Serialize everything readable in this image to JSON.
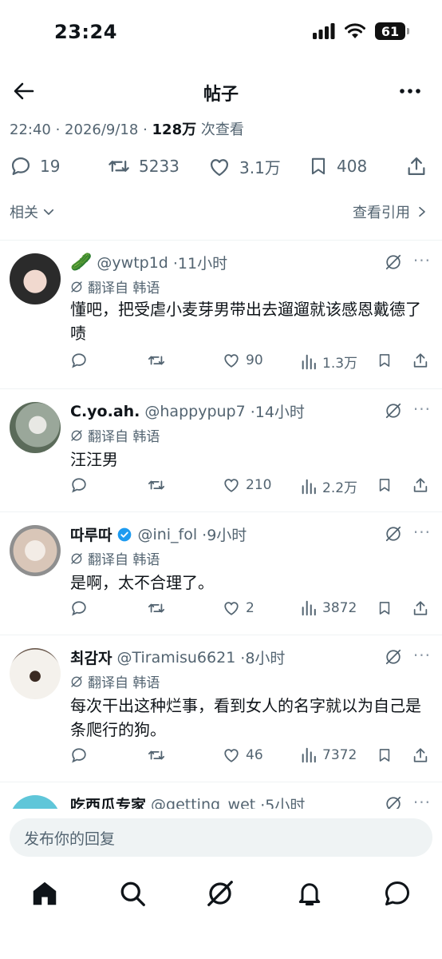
{
  "status_bar": {
    "time": "23:24",
    "battery": "61"
  },
  "header": {
    "title": "帖子"
  },
  "post_meta": {
    "time": "22:40",
    "sep1": " · ",
    "date": "2026/9/18",
    "sep2": " · ",
    "views": "128万",
    "views_suffix": " 次查看"
  },
  "stats": {
    "replies": "19",
    "retweets": "5233",
    "likes": "3.1万",
    "bookmarks": "408"
  },
  "related": {
    "left_label": "相关",
    "right_label": "查看引用"
  },
  "replies": [
    {
      "emoji": "🥒",
      "name": "",
      "handle": "@ywtp1d",
      "time": "·11小时",
      "translate_label": "翻译自 韩语",
      "text": "懂吧，把受虐小麦芽男带出去遛遛就该感恩戴德了啧",
      "likes": "90",
      "views": "1.3万"
    },
    {
      "emoji": "",
      "name": "C.yo.ah.",
      "handle": "@happypup7",
      "time": "·14小时",
      "translate_label": "翻译自 韩语",
      "text": "汪汪男",
      "likes": "210",
      "views": "2.2万"
    },
    {
      "emoji": "",
      "name": "따루따",
      "handle": "@ini_fol",
      "time": "·9小时",
      "translate_label": "翻译自 韩语",
      "text": "是啊，太不合理了。",
      "likes": "2",
      "views": "3872"
    },
    {
      "emoji": "",
      "name": "최감자",
      "handle": "@Tiramisu6621",
      "time": "·8小时",
      "translate_label": "翻译自 韩语",
      "text": "每次干出这种烂事，看到女人的名字就以为自己是条爬行的狗。",
      "likes": "46",
      "views": "7372"
    }
  ],
  "partial_reply": {
    "name": "吃西瓜专家",
    "handle": "@getting_wet",
    "time": "·5小时"
  },
  "composer": {
    "placeholder": "发布你的回复"
  },
  "colors": {
    "text": "#0f1419",
    "secondary": "#536471",
    "verified": "#1d9bf0",
    "divider": "#eff3f4"
  }
}
